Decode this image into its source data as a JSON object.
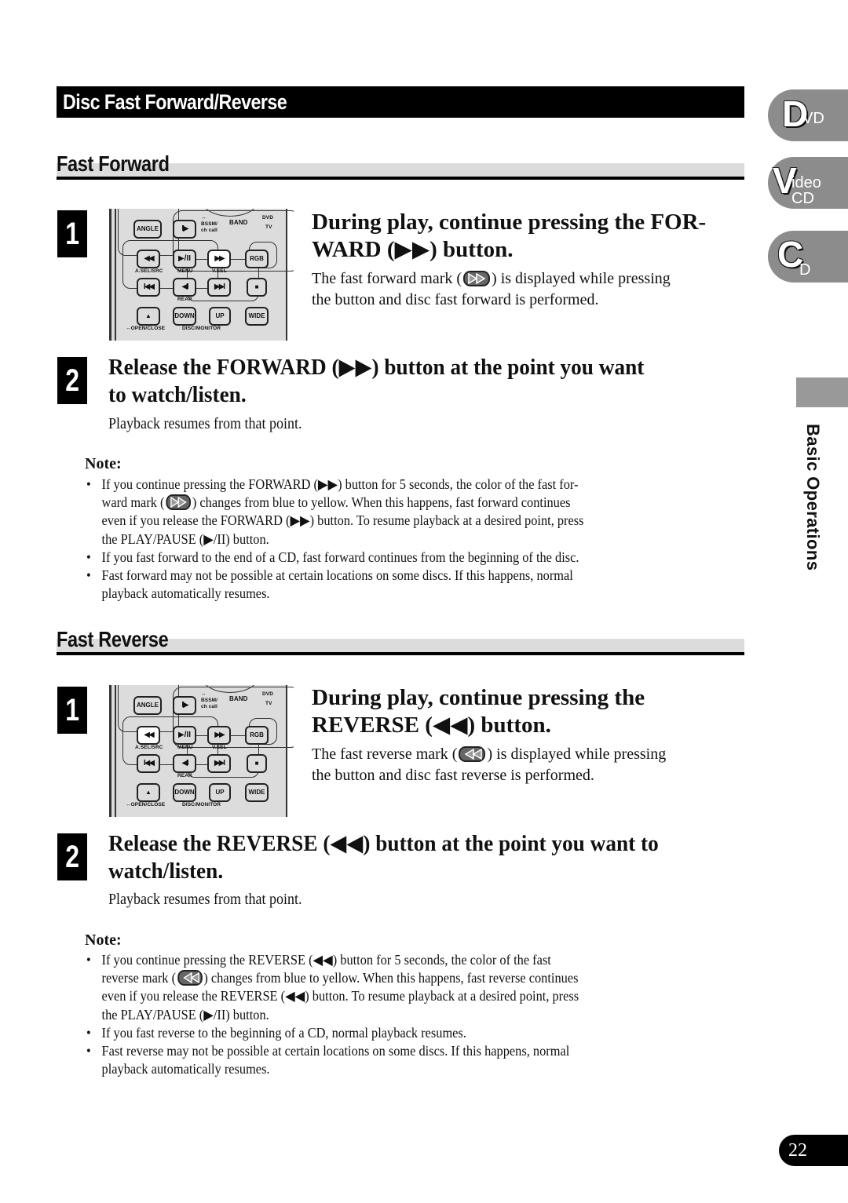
{
  "section_title": "Disc Fast Forward/Reverse",
  "side_tabs": {
    "dvd": {
      "big": "D",
      "small": "VD"
    },
    "video_cd": {
      "big": "V",
      "small_top": "ideo",
      "small_bottom": "CD"
    },
    "cd": {
      "big": "C",
      "small": "D"
    },
    "chapter_label": "Basic Operations"
  },
  "page_number": "22",
  "remote": {
    "buttons": {
      "angle": "ANGLE",
      "step": "II▶",
      "rev": "◀◀",
      "play_pause": "▶/II",
      "fwd": "▶▶",
      "rgb": "RGB",
      "prev": "I◀◀",
      "slow": "◀II",
      "next": "▶▶I",
      "stop": "■",
      "eject": "▲",
      "down": "DOWN",
      "up": "UP",
      "wide": "WIDE"
    },
    "labels": {
      "bssm": "BSSM/",
      "bssm_arrow": "↔",
      "ch_call": "ch call",
      "band": "BAND",
      "dvd": "DVD",
      "tv": "TV",
      "asel": "A.SEL/SRC",
      "menu": "MENU",
      "vsel": "V.SEL",
      "rear": "REAR",
      "open_close": "↔OPEN/CLOSE",
      "disc_monitor": "DISC/MONITOR"
    }
  },
  "fast_forward": {
    "heading": "Fast Forward",
    "step1": {
      "number": "1",
      "title_line1": "During play, continue pressing the FOR-",
      "title_line2": "WARD (▶▶) button.",
      "body_pre": "The fast forward mark (",
      "body_post": ") is displayed while pressing",
      "body_line2": "the button and disc fast forward is performed."
    },
    "step2": {
      "number": "2",
      "title_line1": "Release the FORWARD (▶▶) button at the point you want",
      "title_line2": "to watch/listen.",
      "body": "Playback resumes from that point."
    },
    "note_label": "Note:",
    "notes": [
      {
        "l1": "If you continue pressing the FORWARD (▶▶) button for 5 seconds, the color of the fast for-",
        "l2_pre": "ward mark (",
        "l2_post": ") changes from blue to yellow. When this happens, fast forward continues",
        "l3": "even if you release the FORWARD (▶▶) button. To resume playback at a desired point, press",
        "l4": "the PLAY/PAUSE (▶/II) button."
      },
      {
        "l1": "If you fast forward to the end of a CD, fast forward continues from the beginning of the disc."
      },
      {
        "l1": "Fast forward may not be possible at certain locations on some discs. If this happens, normal",
        "l2": "playback automatically resumes."
      }
    ]
  },
  "fast_reverse": {
    "heading": "Fast Reverse",
    "step1": {
      "number": "1",
      "title_line1": "During play, continue pressing the",
      "title_line2": "REVERSE (◀◀) button.",
      "body_pre": "The fast reverse mark (",
      "body_post": ") is displayed while pressing",
      "body_line2": "the button and disc fast reverse is performed."
    },
    "step2": {
      "number": "2",
      "title_line1": "Release the REVERSE (◀◀) button at the point you want to",
      "title_line2": "watch/listen.",
      "body": "Playback resumes from that point."
    },
    "note_label": "Note:",
    "notes": [
      {
        "l1": "If you continue pressing the REVERSE (◀◀) button for 5 seconds, the color of the fast",
        "l2_pre": "reverse mark (",
        "l2_post": ") changes from blue to yellow. When this happens, fast reverse continues",
        "l3": "even if you release the REVERSE (◀◀) button. To resume playback at a desired point, press",
        "l4": "the PLAY/PAUSE (▶/II) button."
      },
      {
        "l1": "If you fast reverse to the beginning of a CD, normal playback resumes."
      },
      {
        "l1": "Fast reverse may not be possible at certain locations on some discs. If this happens, normal",
        "l2": "playback automatically resumes."
      }
    ]
  },
  "bullet_char": "•"
}
